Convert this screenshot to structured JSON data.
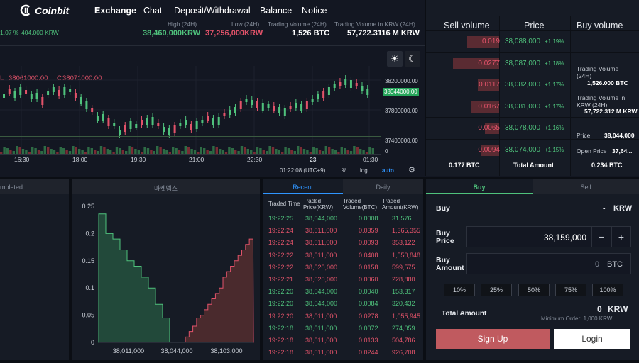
{
  "app": {
    "logo": "Coinbit"
  },
  "nav": [
    "Exchange",
    "Chat",
    "Deposit/Withdrawal",
    "Balance",
    "Notice"
  ],
  "ticker": {
    "change_pct": "1.07 %",
    "change_amt": "404,000 KRW",
    "high_label": "High (24H)",
    "high_value": "38,460,000KRW",
    "low_label": "Low (24H)",
    "low_value": "37,256,000KRW",
    "vol_label": "Trading Volume (24H)",
    "vol_value": "1,526 BTC",
    "volkrw_label": "Trading Volume in KRW (24H)",
    "volkrw_value": "57,722.3116 M KRW"
  },
  "chart": {
    "ohlc_l_label": "L",
    "ohlc_l": "38061000.00",
    "ohlc_c_label": "C",
    "ohlc_c": "38071000.00",
    "current_price": "38044000.00",
    "y_ticks": [
      "38200000.00",
      "37800000.00",
      "37400000.00",
      "0"
    ],
    "x_ticks": [
      "16:30",
      "18:00",
      "19:30",
      "21:00",
      "22:30",
      "23",
      "01:30"
    ],
    "time_label": "01:22:08 (UTC+9)",
    "pct_btn": "%",
    "log_btn": "log",
    "auto_btn": "auto"
  },
  "orderbook": {
    "headers": [
      "Sell volume",
      "Price",
      "Buy volume"
    ],
    "rows": [
      {
        "sell": "0.019",
        "price": "38,088,000",
        "pct": "+1.19%",
        "bar": 0.45
      },
      {
        "sell": "0.0277",
        "price": "38,087,000",
        "pct": "+1.18%",
        "bar": 0.65
      },
      {
        "sell": "0.0117",
        "price": "38,082,000",
        "pct": "+1.17%",
        "bar": 0.3
      },
      {
        "sell": "0.0167",
        "price": "38,081,000",
        "pct": "+1.17%",
        "bar": 0.4
      },
      {
        "sell": "0.0065",
        "price": "38,078,000",
        "pct": "+1.16%",
        "bar": 0.2
      },
      {
        "sell": "0.0094",
        "price": "38,074,000",
        "pct": "+1.15%",
        "bar": 0.25
      }
    ],
    "side": {
      "vol_label": "Trading Volume (24H)",
      "vol_value": "1,526.000 BTC",
      "volkrw_label": "Trading Volume in KRW (24H)",
      "volkrw_value": "57,722.312 M KRW",
      "price_label": "Price",
      "price_value": "38,044,000",
      "open_label": "Open Price",
      "open_value": "37,64..."
    },
    "footer": {
      "sell_total": "0.177 BTC",
      "total_label": "Total Amount",
      "buy_total": "0.234 BTC"
    }
  },
  "left_panel": {
    "tab": "mpleted"
  },
  "depth": {
    "title": "마켓뎁스",
    "y_ticks": [
      "0.25",
      "0.2",
      "0.15",
      "0.1",
      "0.05",
      "0"
    ],
    "x_ticks": [
      "38,011,000",
      "38,044,000",
      "38,103,000"
    ]
  },
  "trades": {
    "tabs": [
      "Recent",
      "Daily"
    ],
    "headers": [
      "Traded Time",
      "Traded Price(KRW)",
      "Traded Volume(BTC)",
      "Traded Amount(KRW)"
    ],
    "rows": [
      {
        "time": "19:22:25",
        "price": "38,044,000",
        "vol": "0.0008",
        "amt": "31,576",
        "side": "buy"
      },
      {
        "time": "19:22:24",
        "price": "38,011,000",
        "vol": "0.0359",
        "amt": "1,365,355",
        "side": "sell"
      },
      {
        "time": "19:22:24",
        "price": "38,011,000",
        "vol": "0.0093",
        "amt": "353,122",
        "side": "sell"
      },
      {
        "time": "19:22:22",
        "price": "38,011,000",
        "vol": "0.0408",
        "amt": "1,550,848",
        "side": "sell"
      },
      {
        "time": "19:22:22",
        "price": "38,020,000",
        "vol": "0.0158",
        "amt": "599,575",
        "side": "sell"
      },
      {
        "time": "19:22:21",
        "price": "38,020,000",
        "vol": "0.0060",
        "amt": "228,880",
        "side": "sell"
      },
      {
        "time": "19:22:20",
        "price": "38,044,000",
        "vol": "0.0040",
        "amt": "153,317",
        "side": "buy"
      },
      {
        "time": "19:22:20",
        "price": "38,044,000",
        "vol": "0.0084",
        "amt": "320,432",
        "side": "buy"
      },
      {
        "time": "19:22:20",
        "price": "38,011,000",
        "vol": "0.0278",
        "amt": "1,055,945",
        "side": "sell"
      },
      {
        "time": "19:22:18",
        "price": "38,011,000",
        "vol": "0.0072",
        "amt": "274,059",
        "side": "buy"
      },
      {
        "time": "19:22:18",
        "price": "38,011,000",
        "vol": "0.0133",
        "amt": "504,786",
        "side": "sell"
      },
      {
        "time": "19:22:18",
        "price": "38,011,000",
        "vol": "0.0244",
        "amt": "926,708",
        "side": "sell"
      }
    ]
  },
  "order_form": {
    "tabs": [
      "Buy",
      "Sell"
    ],
    "buy_label": "Buy",
    "buy_unit_dash": "-",
    "buy_unit": "KRW",
    "price_label": "Buy\nPrice",
    "price_value": "38,159,000",
    "amount_label": "Buy\nAmount",
    "amount_value": "0",
    "amount_unit": "BTC",
    "pct_buttons": [
      "10%",
      "25%",
      "50%",
      "75%",
      "100%"
    ],
    "total_label": "Total Amount",
    "total_value": "0",
    "total_unit": "KRW",
    "min_order": "Minimum Order: 1,000 KRW",
    "signup": "Sign Up",
    "login": "Login"
  },
  "colors": {
    "up": "#4fc27c",
    "down": "#e3536a",
    "bg": "#131722",
    "panel": "#161b25"
  }
}
